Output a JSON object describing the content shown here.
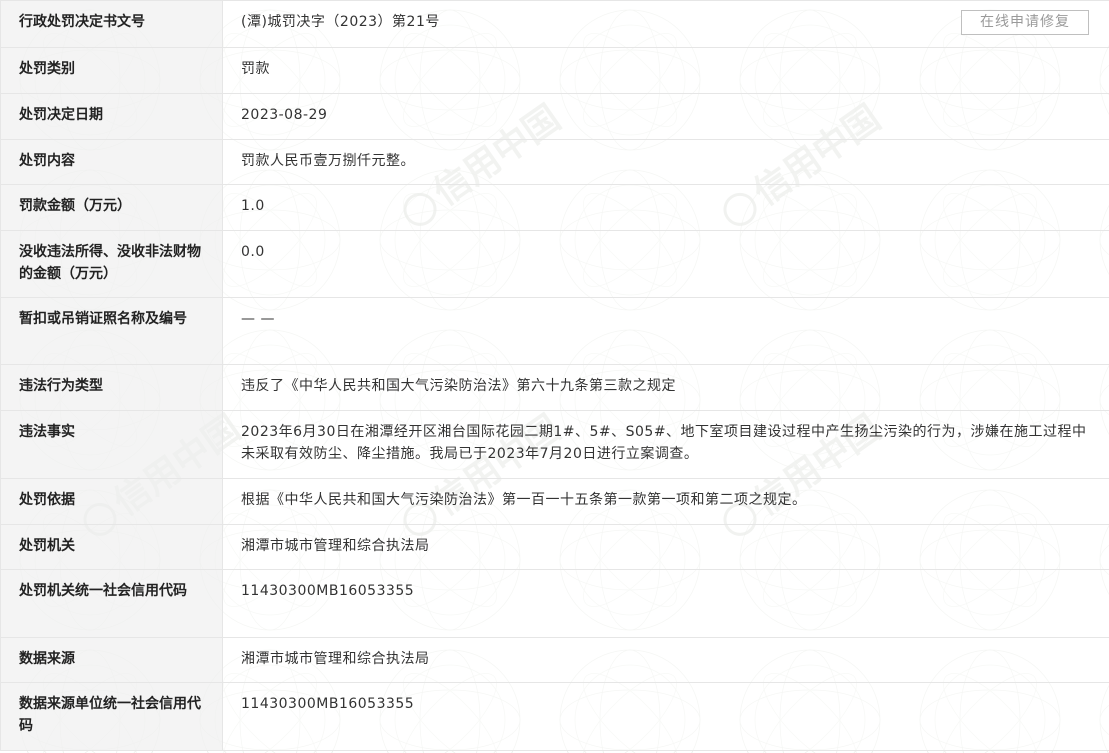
{
  "repair_button_label": "在线申请修复",
  "watermark": {
    "text": "信用中国",
    "color": "#d8dcd6"
  },
  "rows": [
    {
      "label": "行政处罚决定书文号",
      "value": "(潭)城罚决字（2023）第21号"
    },
    {
      "label": "处罚类别",
      "value": "罚款"
    },
    {
      "label": "处罚决定日期",
      "value": "2023-08-29"
    },
    {
      "label": "处罚内容",
      "value": "罚款人民币壹万捌仟元整。"
    },
    {
      "label": "罚款金额（万元）",
      "value": "1.0"
    },
    {
      "label": "没收违法所得、没收非法财物的金额（万元）",
      "value": "0.0"
    },
    {
      "label": "暂扣或吊销证照名称及编号",
      "value": "— —"
    },
    {
      "label": "违法行为类型",
      "value": "违反了《中华人民共和国大气污染防治法》第六十九条第三款之规定"
    },
    {
      "label": "违法事实",
      "value": "2023年6月30日在湘潭经开区湘台国际花园二期1#、5#、S05#、地下室项目建设过程中产生扬尘污染的行为，涉嫌在施工过程中未采取有效防尘、降尘措施。我局已于2023年7月20日进行立案调查。"
    },
    {
      "label": "处罚依据",
      "value": "根据《中华人民共和国大气污染防治法》第一百一十五条第一款第一项和第二项之规定。"
    },
    {
      "label": "处罚机关",
      "value": "湘潭市城市管理和综合执法局"
    },
    {
      "label": "处罚机关统一社会信用代码",
      "value": "11430300MB16053355"
    },
    {
      "label": "数据来源",
      "value": "湘潭市城市管理和综合执法局"
    },
    {
      "label": "数据来源单位统一社会信用代码",
      "value": "11430300MB16053355"
    }
  ]
}
